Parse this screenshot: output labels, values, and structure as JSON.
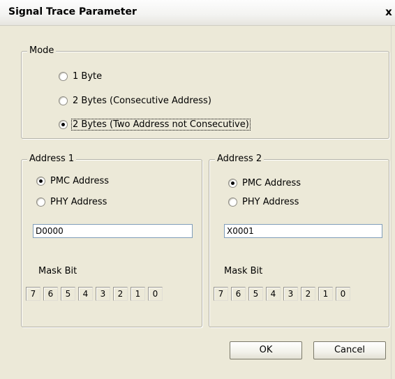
{
  "window": {
    "title": "Signal Trace Parameter",
    "close_symbol": "x"
  },
  "mode": {
    "legend": "Mode",
    "options": [
      {
        "label": "1 Byte",
        "checked": false
      },
      {
        "label": "2 Bytes (Consecutive Address)",
        "checked": false
      },
      {
        "label": "2 Bytes (Two Address not Consecutive)",
        "checked": true
      }
    ]
  },
  "address1": {
    "legend": "Address 1",
    "options": [
      {
        "label": "PMC Address",
        "checked": true
      },
      {
        "label": "PHY Address",
        "checked": false
      }
    ],
    "value": "D0000",
    "mask_label": "Mask Bit",
    "bits": [
      "7",
      "6",
      "5",
      "4",
      "3",
      "2",
      "1",
      "0"
    ]
  },
  "address2": {
    "legend": "Address 2",
    "options": [
      {
        "label": "PMC Address",
        "checked": true
      },
      {
        "label": "PHY Address",
        "checked": false
      }
    ],
    "value": "X0001",
    "mask_label": "Mask Bit",
    "bits": [
      "7",
      "6",
      "5",
      "4",
      "3",
      "2",
      "1",
      "0"
    ]
  },
  "buttons": {
    "ok": "OK",
    "cancel": "Cancel"
  },
  "icons": {
    "close": "close-icon",
    "radio": "radio-button-icon"
  }
}
